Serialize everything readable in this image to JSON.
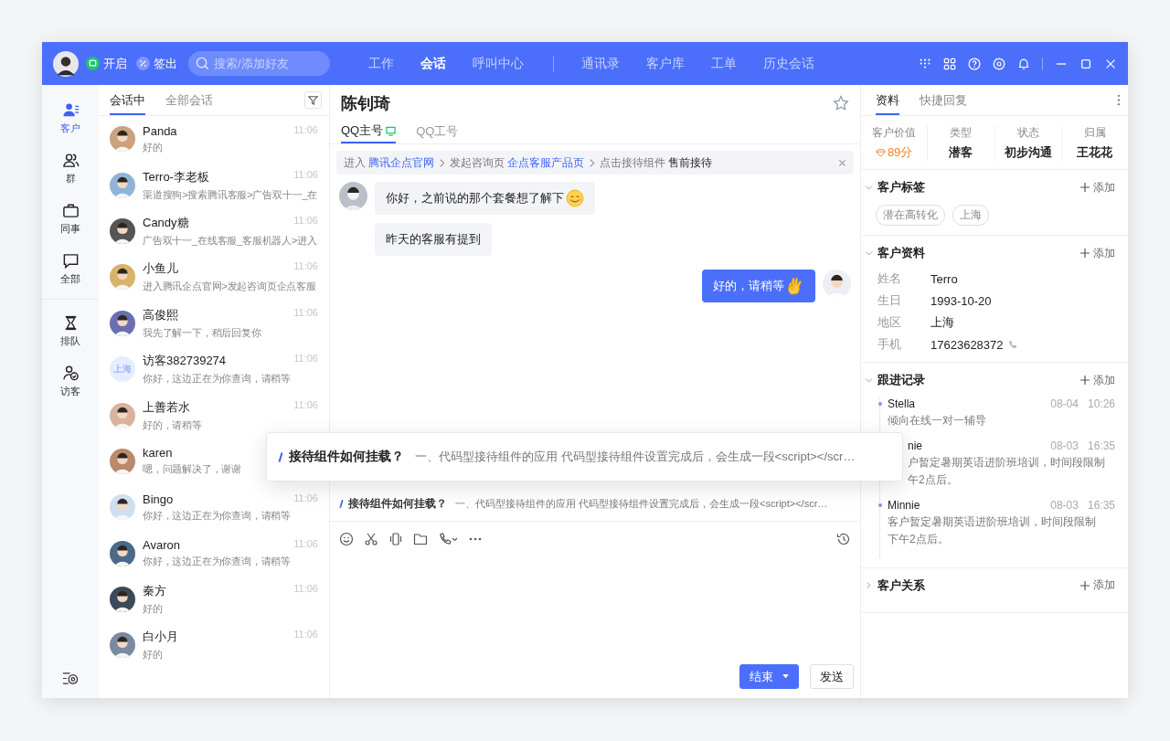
{
  "topbar": {
    "toggles": [
      {
        "label": "开启",
        "kind": "online"
      },
      {
        "label": "签出",
        "kind": "checkout"
      }
    ],
    "search": {
      "placeholder": "搜索/添加好友"
    },
    "nav_main": [
      {
        "label": "工作",
        "selected": false
      },
      {
        "label": "会话",
        "selected": true
      },
      {
        "label": "呼叫中心",
        "selected": false
      }
    ],
    "nav_more": [
      {
        "label": "通讯录",
        "selected": false
      },
      {
        "label": "客户库",
        "selected": false
      },
      {
        "label": "工单",
        "selected": false
      },
      {
        "label": "历史会话",
        "selected": false
      }
    ]
  },
  "sidebar": {
    "groups": [
      [
        {
          "label": "客户",
          "kind": "customer",
          "selected": true
        },
        {
          "label": "群",
          "kind": "group",
          "selected": false
        },
        {
          "label": "同事",
          "kind": "colleague",
          "selected": false
        },
        {
          "label": "全部",
          "kind": "all",
          "selected": false
        }
      ],
      [
        {
          "label": "排队",
          "kind": "queue",
          "selected": false
        },
        {
          "label": "访客",
          "kind": "visitor",
          "selected": false
        }
      ]
    ]
  },
  "session_tabs": [
    {
      "label": "会话中",
      "selected": true
    },
    {
      "label": "全部会话",
      "selected": false
    }
  ],
  "sessions": [
    {
      "name": "Panda",
      "preview": "好的",
      "time": "11:06"
    },
    {
      "name": "Terro-李老板",
      "preview": "渠道搜狗>搜索腾讯客服>广告双十一_在",
      "time": "11:06"
    },
    {
      "name": "Candy糖",
      "preview": "广告双十一_在线客服_客服机器人>进入",
      "time": "11:06"
    },
    {
      "name": "小鱼儿",
      "preview": "进入腾讯企点官网>发起咨询页企点客服",
      "time": "11:06"
    },
    {
      "name": "高俊熙",
      "preview": "我先了解一下，稍后回复你",
      "time": "11:06"
    },
    {
      "name": "访客382739274",
      "preview": "你好，这边正在为你查询，请稍等",
      "time": "11:06",
      "badge": "上海"
    },
    {
      "name": "上善若水",
      "preview": "好的，请稍等",
      "time": "11:06"
    },
    {
      "name": "karen",
      "preview": "嗯，问题解决了，谢谢"
    },
    {
      "name": "Bingo",
      "preview": "你好，这边正在为你查询，请稍等",
      "time": "11:06"
    },
    {
      "name": "Avaron",
      "preview": "你好，这边正在为你查询，请稍等",
      "time": "11:06"
    },
    {
      "name": "秦方",
      "preview": "好的",
      "time": "11:06"
    },
    {
      "name": "白小月",
      "preview": "好的",
      "time": "11:06"
    }
  ],
  "chat": {
    "title": "陈钊琦",
    "accounts": [
      {
        "label": "QQ主号",
        "selected": true,
        "online": true
      },
      {
        "label": "QQ工号",
        "selected": false,
        "online": false
      }
    ],
    "breadcrumb": [
      {
        "kind": "plain",
        "text": "进入"
      },
      {
        "kind": "link",
        "text": "腾讯企点官网"
      },
      {
        "kind": "sep"
      },
      {
        "kind": "plain",
        "text": "发起咨询页"
      },
      {
        "kind": "link",
        "text": "企点客服产品页"
      },
      {
        "kind": "sep"
      },
      {
        "kind": "plain",
        "text": "点击接待组件"
      },
      {
        "kind": "strong",
        "text": "售前接待"
      }
    ],
    "messages": [
      {
        "kind": "in",
        "text": "你好，之前说的那个套餐想了解下",
        "emoji": {
          "kind": "smile"
        },
        "avatar": true
      },
      {
        "kind": "in",
        "text": "昨天的客服有提到",
        "avatar": false
      },
      {
        "kind": "out",
        "text": "好的，请稍等",
        "emoji": {
          "kind": "ok"
        },
        "avatar": true
      }
    ],
    "suggestion": {
      "title": "接待组件如何挂载？",
      "text": "一、代码型接待组件的应用 代码型接待组件设置完成后，会生成一段<script></scr…"
    },
    "buttons": [
      {
        "label": "结束",
        "kind": "primary"
      },
      {
        "label": "发送",
        "kind": "default"
      }
    ]
  },
  "popup": {
    "title": "接待组件如何挂载？",
    "text": "一、代码型接待组件的应用 代码型接待组件设置完成后，会生成一段<script></scr…"
  },
  "panel": {
    "tabs": [
      {
        "label": "资料",
        "selected": true
      },
      {
        "label": "快捷回复",
        "selected": false
      }
    ],
    "stats": [
      {
        "label": "客户价值",
        "value": "89分",
        "kind": "score"
      },
      {
        "label": "类型",
        "value": "潜客",
        "kind": "plain"
      },
      {
        "label": "状态",
        "value": "初步沟通",
        "kind": "plain"
      },
      {
        "label": "归属",
        "value": "王花花",
        "kind": "plain"
      }
    ],
    "sections": [
      {
        "title": "客户标签",
        "action": "添加",
        "expanded": true,
        "kind": "tags",
        "tags": [
          "潜在高转化",
          "上海"
        ]
      },
      {
        "title": "客户资料",
        "action": "添加",
        "expanded": true,
        "kind": "fields",
        "fields": [
          {
            "label": "姓名",
            "value": "Terro"
          },
          {
            "label": "生日",
            "value": "1993-10-20"
          },
          {
            "label": "地区",
            "value": "上海"
          },
          {
            "label": "手机",
            "value": "17623628372",
            "phone": true
          }
        ]
      },
      {
        "title": "跟进记录",
        "action": "添加",
        "expanded": true,
        "kind": "records",
        "records": [
          {
            "name": "Stella",
            "date": "08-04",
            "time": "10:26",
            "text": "倾向在线一对一辅导"
          },
          {
            "name": "nie",
            "date": "08-03",
            "time": "16:35",
            "text": "户暂定暑期英语进阶班培训，时间段限制",
            "more": "午2点后。",
            "covered": true
          },
          {
            "name": "Minnie",
            "date": "08-03",
            "time": "16:35",
            "text": "客户暂定暑期英语进阶班培训，时间段限制",
            "more": "下午2点后。"
          }
        ]
      },
      {
        "title": "客户关系",
        "action": "添加",
        "expanded": false
      }
    ]
  }
}
